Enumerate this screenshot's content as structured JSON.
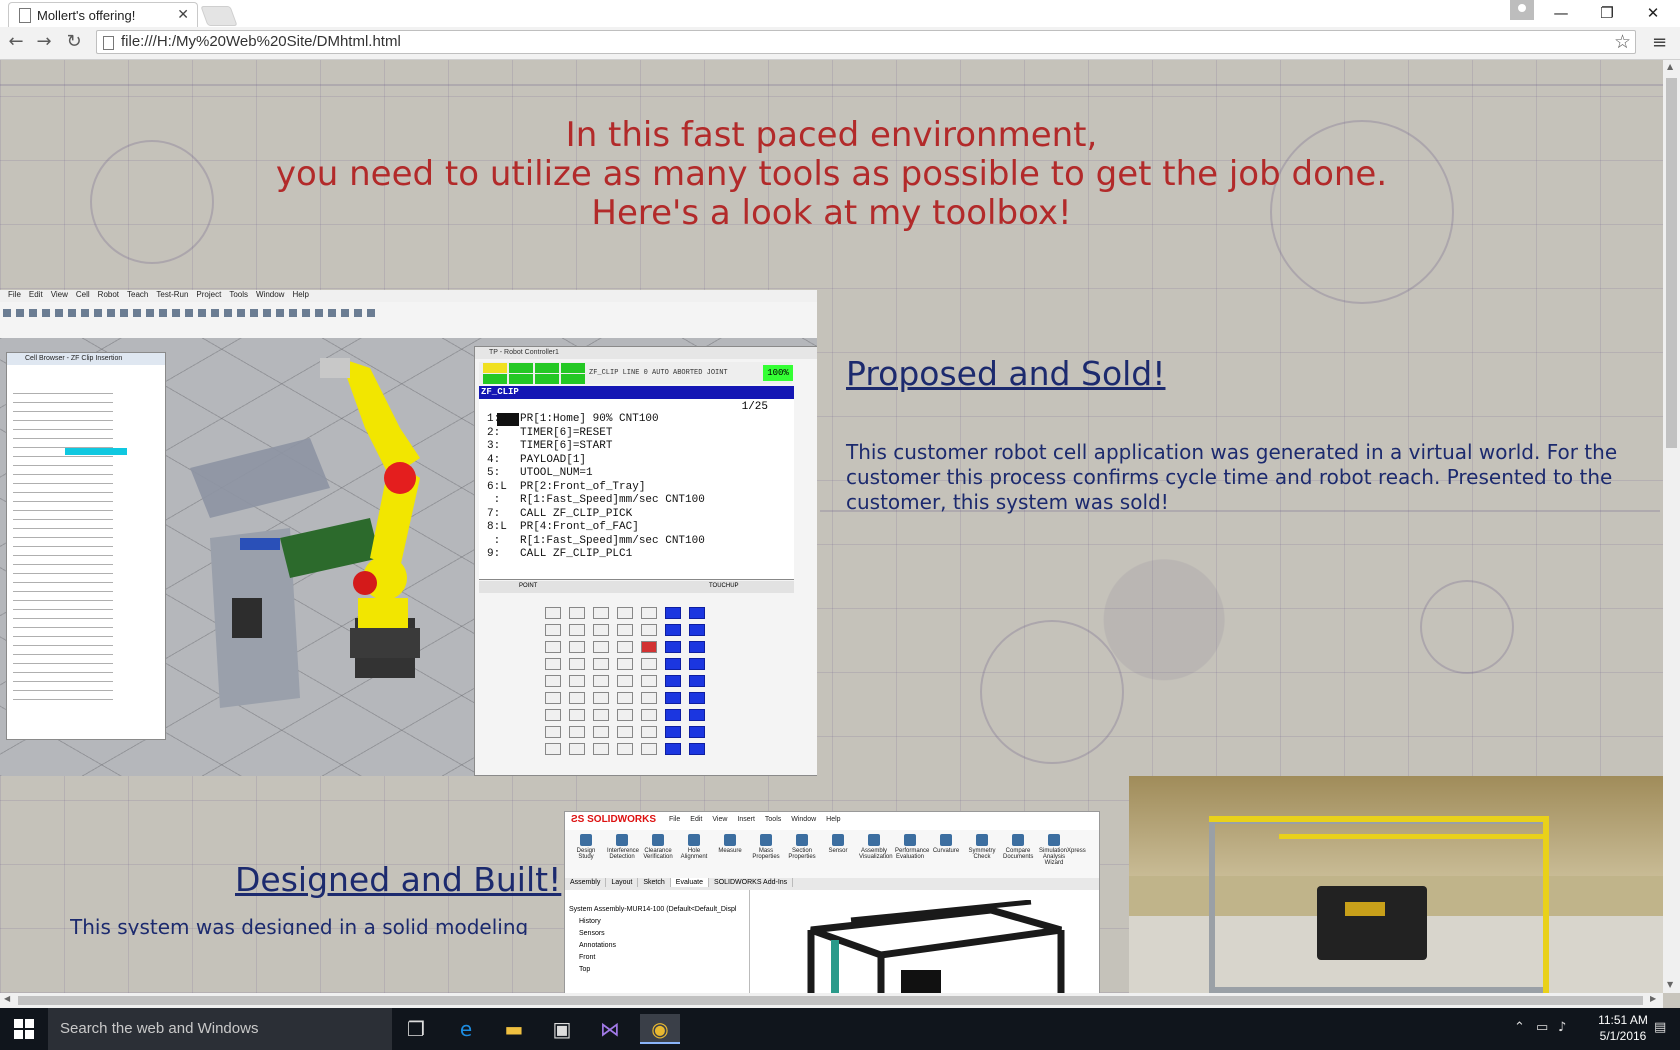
{
  "browser": {
    "tab_title": "Mollert's offering!",
    "tab_close": "✕",
    "url": "file:///H:/My%20Web%20Site/DMhtml.html",
    "back_icon": "arrow-left",
    "forward_icon": "arrow-right",
    "reload_icon": "reload",
    "bookmark_icon": "star",
    "menu_icon": "hamburger",
    "window_controls": {
      "minimize": "—",
      "restore": "❐",
      "close": "✕"
    }
  },
  "page": {
    "headline_lines": [
      "In this fast paced environment,",
      "you need to utilize as many tools as possible to get the job done.",
      "Here's a look at my toolbox!"
    ],
    "section1": {
      "heading": "Proposed and Sold!",
      "body": "This customer robot cell application was generated in a virtual world. For the customer this process confirms cycle time and robot reach. Presented to the customer, this system was sold!"
    },
    "section2": {
      "heading": "Designed and Built!",
      "body_partial": "This system was designed in a solid modeling"
    },
    "colors": {
      "headline": "#b22a2a",
      "section_text": "#1c2a6e"
    }
  },
  "roboguide": {
    "menu": [
      "File",
      "Edit",
      "View",
      "Cell",
      "Robot",
      "Teach",
      "Test-Run",
      "Project",
      "Tools",
      "Window",
      "Help"
    ],
    "cell_browser_title": "Cell Browser - ZF Clip Insertion",
    "teach_pendant": {
      "title": "TP - Robot Controller1",
      "status": "ZF_CLIP LINE 0  AUTO ABORTED  JOINT",
      "override": "100%",
      "program": "ZF_CLIP",
      "line_count": "1/25",
      "code": [
        "1:J  PR[1:Home] 90% CNT100",
        "2:   TIMER[6]=RESET",
        "3:   TIMER[6]=START",
        "4:   PAYLOAD[1]",
        "5:   UTOOL_NUM=1",
        "6:L  PR[2:Front_of_Tray]",
        " :   R[1:Fast_Speed]mm/sec CNT100",
        "7:   CALL ZF_CLIP_PICK",
        "8:L  PR[4:Front_of_FAC]",
        " :   R[1:Fast_Speed]mm/sec CNT100",
        "9:   CALL ZF_CLIP_PLC1"
      ],
      "fkeys": [
        "POINT",
        "TOUCHUP"
      ]
    }
  },
  "solidworks": {
    "logo": "SOLIDWORKS",
    "menu": [
      "File",
      "Edit",
      "View",
      "Insert",
      "Tools",
      "Window",
      "Help"
    ],
    "ribbon": [
      "Design Study",
      "Interference Detection",
      "Clearance Verification",
      "Hole Alignment",
      "Measure",
      "Mass Properties",
      "Section Properties",
      "Sensor",
      "Assembly Visualization",
      "Performance Evaluation",
      "Curvature",
      "Symmetry Check",
      "Compare Documents",
      "SimulationXpress Analysis Wizard"
    ],
    "tabs": [
      "Assembly",
      "Layout",
      "Sketch",
      "Evaluate",
      "SOLIDWORKS Add-Ins"
    ],
    "tree": [
      "System Assembly-MUR14-100  (Default<Default_Displ",
      "History",
      "Sensors",
      "Annotations",
      "Front",
      "Top"
    ]
  },
  "taskbar": {
    "search_placeholder": "Search the web and Windows",
    "time": "11:51 AM",
    "date": "5/1/2016"
  }
}
